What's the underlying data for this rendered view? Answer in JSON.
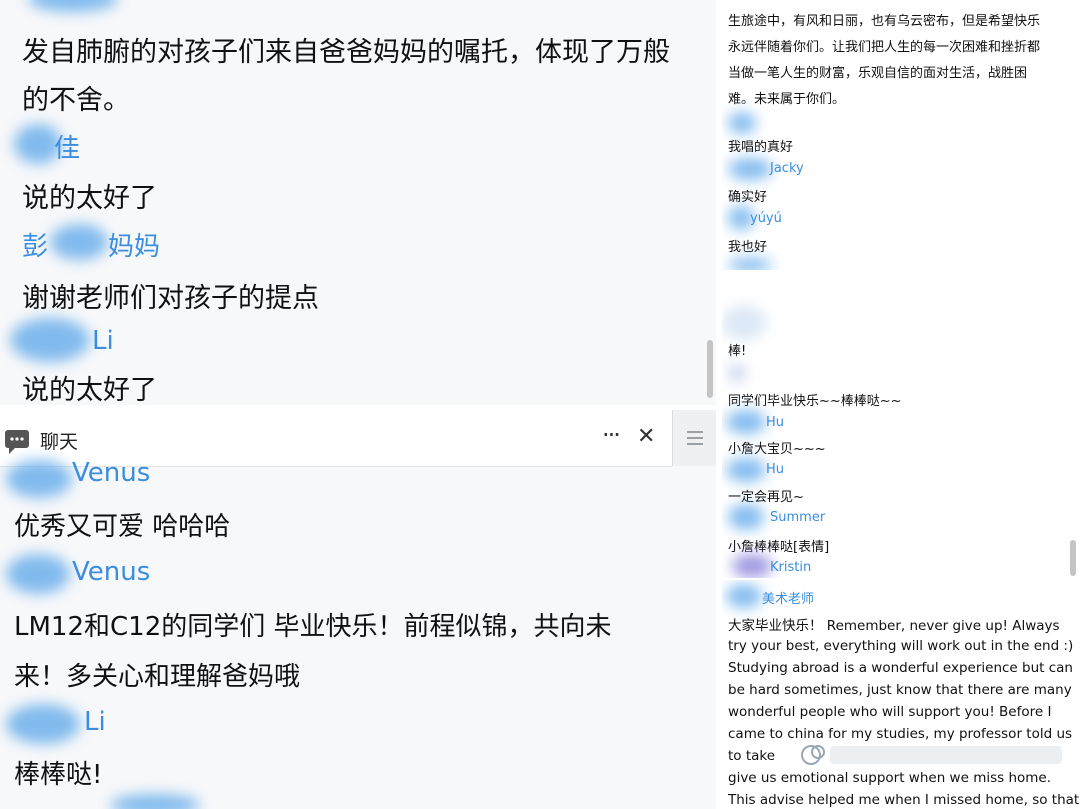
{
  "top_chat": {
    "messages": [
      {
        "text": "发自肺腑的对孩子们来自爸爸妈妈的嘱托，体现了万般"
      },
      {
        "text": "的不舍。"
      },
      {
        "name": "佳",
        "text": "说的太好了"
      },
      {
        "name_left": "彭",
        "name_right": "妈妈",
        "text": "谢谢老师们对孩子的提点"
      },
      {
        "name": "Li",
        "text": "说的太好了"
      }
    ]
  },
  "chat_window": {
    "title": "聊天",
    "more_icon": "···",
    "close_icon": "✕",
    "messages": [
      {
        "name": "Venus",
        "text": "优秀又可爱  哈哈哈"
      },
      {
        "name": "Venus",
        "text_lines": [
          "LM12和C12的同学们  毕业快乐！前程似锦，共向未",
          "来！多关心和理解爸妈哦"
        ]
      },
      {
        "name": "Li",
        "text": "棒棒哒!"
      }
    ]
  },
  "side_chat_top": {
    "lines": [
      "生旅途中，有风和日丽，也有乌云密布，但是希望快乐",
      "永远伴随着你们。让我们把人生的每一次困难和挫折都",
      "当做一笔人生的财富，乐观自信的面对生活，战胜困",
      "难。未来属于你们。"
    ],
    "messages": [
      {
        "text": "我唱的真好"
      },
      {
        "name": "Jacky",
        "text": "确实好"
      },
      {
        "name": "yúyú",
        "text": "我也好"
      }
    ]
  },
  "side_chat_mid": {
    "messages": [
      {
        "text": "棒!"
      },
      {
        "text": "同学们毕业快乐~~棒棒哒~~"
      },
      {
        "name": "Hu",
        "text": "小詹大宝贝~~~"
      },
      {
        "name": "Hu",
        "text": "一定会再见~"
      },
      {
        "name": "Summer",
        "text": "小詹棒棒哒[表情]"
      },
      {
        "name": "Kristin",
        "text": ""
      }
    ]
  },
  "side_chat_bottom": {
    "name": "美术老师",
    "lines": [
      "大家毕业快乐！ Remember, never give up! Always",
      "try your best, everything will work out in the end :)",
      "Studying abroad is a wonderful experience but can",
      "be hard sometimes, just know that there are many",
      "wonderful people who will support you! Before I",
      "came to china for my studies, my professor told us",
      "to take",
      "give us emotional support when we miss home.",
      "This advise helped me when I missed home, so that"
    ]
  }
}
